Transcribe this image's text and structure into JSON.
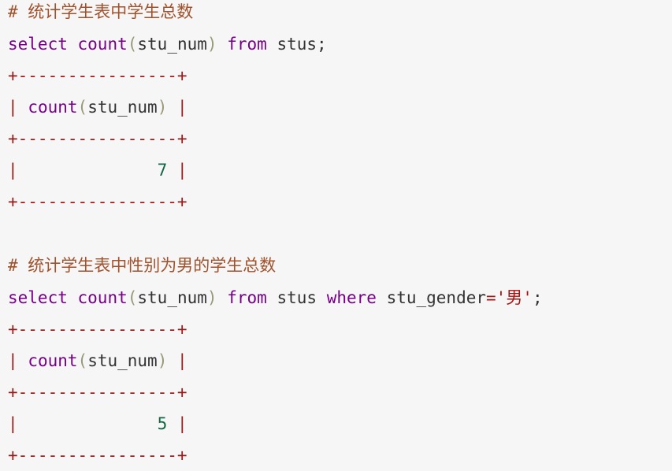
{
  "block1": {
    "comment": "# 统计学生表中学生总数",
    "sql": {
      "kw_select": "select",
      "fn_count": "count",
      "paren_open": "(",
      "arg": "stu_num",
      "paren_close": ")",
      "kw_from": "from",
      "table": "stus",
      "semicolon": ";"
    },
    "result": {
      "border": "+----------------+",
      "bar": "|",
      "header_fn": "count",
      "paren_open": "(",
      "header_arg": "stu_num",
      "paren_close": ")",
      "value": "7"
    }
  },
  "block2": {
    "comment": "# 统计学生表中性别为男的学生总数",
    "sql": {
      "kw_select": "select",
      "fn_count": "count",
      "paren_open": "(",
      "arg": "stu_num",
      "paren_close": ")",
      "kw_from": "from",
      "table": "stus",
      "kw_where": "where",
      "column": "stu_gender",
      "equals": "=",
      "string_value": "'男'",
      "semicolon": ";"
    },
    "result": {
      "border": "+----------------+",
      "bar": "|",
      "header_fn": "count",
      "paren_open": "(",
      "header_arg": "stu_num",
      "paren_close": ")",
      "value": "5"
    }
  },
  "colors": {
    "background": "#f6f6f6",
    "comment": "#a0522d",
    "keyword": "#770088",
    "bracket": "#999977",
    "operator": "#981a1a",
    "string": "#aa1111",
    "number": "#116644",
    "text": "#333333"
  }
}
